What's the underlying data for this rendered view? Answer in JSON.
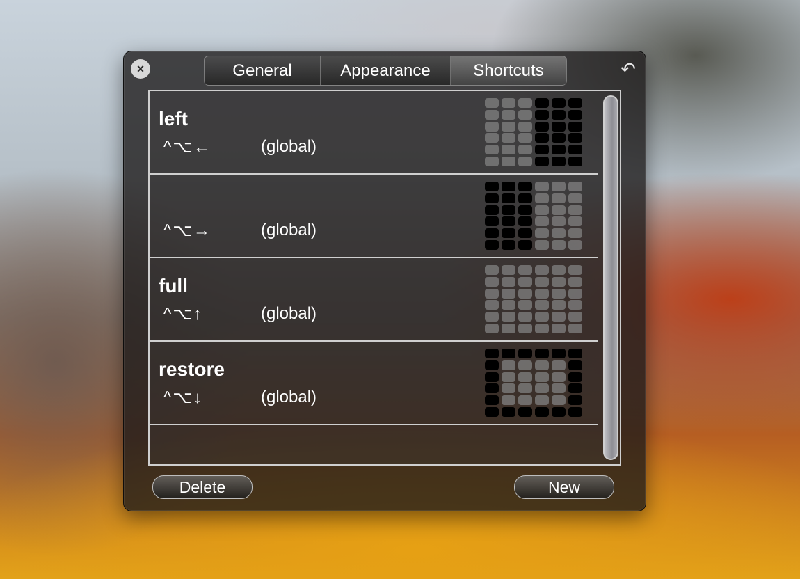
{
  "window": {
    "close_icon": "close-icon",
    "undo_icon": "undo-icon",
    "close_glyph": "×",
    "undo_glyph": "↶"
  },
  "tabs": [
    {
      "label": "General",
      "active": false
    },
    {
      "label": "Appearance",
      "active": false
    },
    {
      "label": "Shortcuts",
      "active": true
    }
  ],
  "shortcuts": [
    {
      "name": "left",
      "keys": "^⌥←",
      "scope": "(global)",
      "layout": [
        [
          0,
          0,
          0,
          1,
          1,
          1
        ],
        [
          0,
          0,
          0,
          1,
          1,
          1
        ],
        [
          0,
          0,
          0,
          1,
          1,
          1
        ],
        [
          0,
          0,
          0,
          1,
          1,
          1
        ],
        [
          0,
          0,
          0,
          1,
          1,
          1
        ],
        [
          0,
          0,
          0,
          1,
          1,
          1
        ]
      ]
    },
    {
      "name": "",
      "keys": "^⌥→",
      "scope": "(global)",
      "layout": [
        [
          1,
          1,
          1,
          0,
          0,
          0
        ],
        [
          1,
          1,
          1,
          0,
          0,
          0
        ],
        [
          1,
          1,
          1,
          0,
          0,
          0
        ],
        [
          1,
          1,
          1,
          0,
          0,
          0
        ],
        [
          1,
          1,
          1,
          0,
          0,
          0
        ],
        [
          1,
          1,
          1,
          0,
          0,
          0
        ]
      ]
    },
    {
      "name": "full",
      "keys": "^⌥↑",
      "scope": "(global)",
      "layout": [
        [
          0,
          0,
          0,
          0,
          0,
          0
        ],
        [
          0,
          0,
          0,
          0,
          0,
          0
        ],
        [
          0,
          0,
          0,
          0,
          0,
          0
        ],
        [
          0,
          0,
          0,
          0,
          0,
          0
        ],
        [
          0,
          0,
          0,
          0,
          0,
          0
        ],
        [
          0,
          0,
          0,
          0,
          0,
          0
        ]
      ]
    },
    {
      "name": "restore",
      "keys": "^⌥↓",
      "scope": "(global)",
      "layout": [
        [
          1,
          1,
          1,
          1,
          1,
          1
        ],
        [
          1,
          0,
          0,
          0,
          0,
          1
        ],
        [
          1,
          0,
          0,
          0,
          0,
          1
        ],
        [
          1,
          0,
          0,
          0,
          0,
          1
        ],
        [
          1,
          0,
          0,
          0,
          0,
          1
        ],
        [
          1,
          1,
          1,
          1,
          1,
          1
        ]
      ]
    }
  ],
  "buttons": {
    "delete_label": "Delete",
    "new_label": "New"
  }
}
